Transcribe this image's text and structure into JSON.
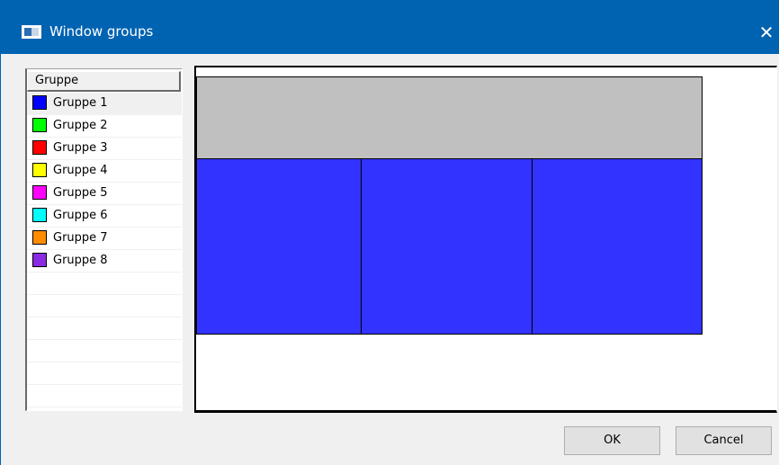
{
  "window": {
    "title": "Window groups",
    "close_glyph": "✕",
    "accent_color": "#0063b1"
  },
  "group_list": {
    "header": "Gruppe",
    "selected_index": 0,
    "groups": [
      {
        "label": "Gruppe 1",
        "color": "#0000ff"
      },
      {
        "label": "Gruppe 2",
        "color": "#00ff00"
      },
      {
        "label": "Gruppe 3",
        "color": "#ff0000"
      },
      {
        "label": "Gruppe 4",
        "color": "#ffff00"
      },
      {
        "label": "Gruppe 5",
        "color": "#ff00ff"
      },
      {
        "label": "Gruppe 6",
        "color": "#00ffff"
      },
      {
        "label": "Gruppe 7",
        "color": "#ff8c00"
      },
      {
        "label": "Gruppe 8",
        "color": "#8a2be2"
      }
    ],
    "empty_rows": 6
  },
  "canvas": {
    "screens": [
      {
        "name": "screen-top",
        "color": "#c0c0c0"
      },
      {
        "name": "screen-bottom-left",
        "color": "#3333ff"
      },
      {
        "name": "screen-bottom-middle",
        "color": "#3333ff"
      },
      {
        "name": "screen-bottom-right",
        "color": "#3333ff"
      }
    ]
  },
  "buttons": {
    "ok_label": "OK",
    "cancel_label": "Cancel"
  }
}
